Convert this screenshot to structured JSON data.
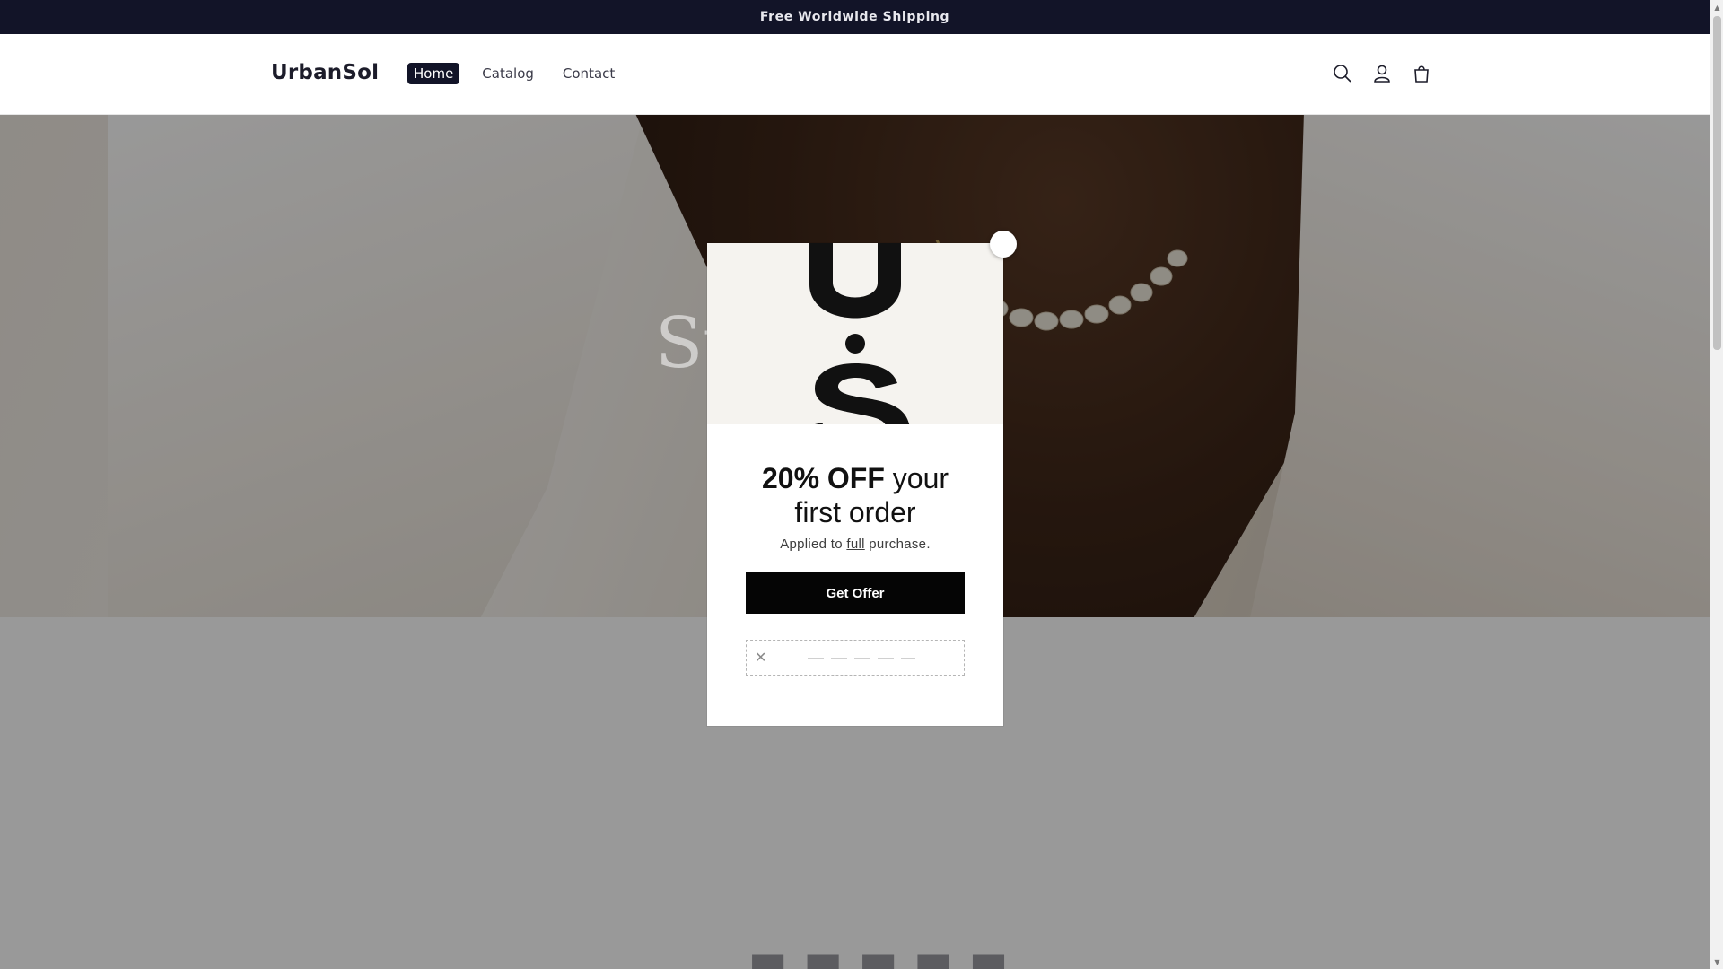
{
  "announcement": {
    "text": "Free Worldwide Shipping"
  },
  "header": {
    "logo": "UrbanSol",
    "nav": [
      {
        "label": "Home",
        "active": true
      },
      {
        "label": "Catalog",
        "active": false
      },
      {
        "label": "Contact",
        "active": false
      }
    ],
    "icons": [
      "search-icon",
      "account-icon",
      "cart-icon"
    ]
  },
  "hero": {
    "title_partial": "St"
  },
  "popup": {
    "logo_letters": "US",
    "headline_bold": "20% OFF",
    "headline_rest_1": " your",
    "headline_line_2": "first order",
    "sub_prefix": "Applied to ",
    "sub_link": "full",
    "sub_suffix": " purchase.",
    "cta_label": "Get Offer"
  },
  "colors": {
    "announcement_bg": "#121428",
    "cta_bg": "#050505",
    "overlay": "rgba(0,0,0,0.40)"
  }
}
